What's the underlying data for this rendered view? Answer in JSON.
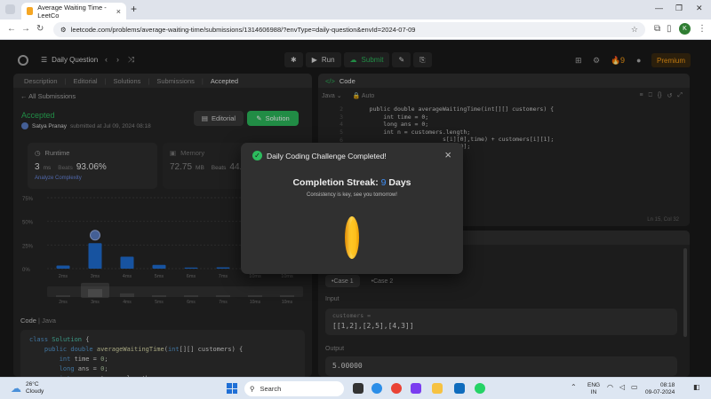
{
  "browser": {
    "tab_title": "Average Waiting Time - LeetCo",
    "url": "leetcode.com/problems/average-waiting-time/submissions/1314606988/?envType=daily-question&envId=2024-07-09",
    "profile_initial": "K"
  },
  "nav": {
    "daily_question": "Daily Question",
    "run": "Run",
    "submit": "Submit",
    "streak_count": "9",
    "premium": "Premium"
  },
  "left": {
    "tabs": [
      "Description",
      "Editorial",
      "Solutions",
      "Submissions",
      "Accepted"
    ],
    "all_submissions": "All Submissions",
    "status": "Accepted",
    "submitter": "Satya Pranay",
    "submitted_on": "submitted at Jul 09, 2024 08:18",
    "editorial_btn": "Editorial",
    "solution_btn": "Solution",
    "runtime": {
      "label": "Runtime",
      "value": "3",
      "unit": "ms",
      "beats_label": "Beats",
      "beats_pct": "93.06%",
      "analyze": "Analyze Complexity"
    },
    "memory": {
      "label": "Memory",
      "value": "72.75",
      "unit": "MB",
      "beats_label": "Beats",
      "beats_pct": "44.0"
    },
    "code_label": "Code",
    "code_lang": "Java",
    "code_lines": [
      "class Solution {",
      "    public double averageWaitingTime(int[][] customers) {",
      "        int time = 0;",
      "        long ans = 0;",
      "        int n = customers.length;"
    ]
  },
  "chart_data": {
    "type": "bar",
    "categories": [
      "2ms",
      "3ms",
      "4ms",
      "5ms",
      "6ms",
      "7ms",
      "10ms",
      "10ms"
    ],
    "values": [
      3.3,
      26.9,
      12.6,
      4.0,
      1.2,
      1.4,
      1.0,
      0.8
    ],
    "highlight_index": 1,
    "y_ticks": [
      "0%",
      "25%",
      "50%",
      "75%"
    ],
    "ylim": [
      0,
      75
    ],
    "grid": true,
    "color": "#1f6fd6"
  },
  "code": {
    "header": "Code",
    "lang": "Java",
    "mode": "Auto",
    "line_numbers": [
      "2",
      "3",
      "4",
      "5",
      "6",
      "7",
      "8",
      "9",
      "10",
      "11",
      "12",
      "13",
      "14"
    ],
    "lines": [
      "    public double averageWaitingTime(int[][] customers) {",
      "        int time = 0;",
      "        long ans = 0;",
      "        int n = customers.length;",
      "",
      "",
      "",
      "",
      "",
      "",
      "",
      "",
      ""
    ],
    "right_fragments": [
      "s[i][0],time) + customers[i][1];",
      "s[i][0];"
    ],
    "cursor": "Ln 15, Col 32"
  },
  "console": {
    "cases": [
      "Case 1",
      "Case 2"
    ],
    "input_label": "Input",
    "input_var": "customers =",
    "input_value": "[[1,2],[2,5],[4,3]]",
    "output_label": "Output",
    "output_value": "5.00000"
  },
  "modal": {
    "title": "Daily Coding Challenge Completed!",
    "streak_label": "Completion Streak:",
    "streak_value": "9",
    "streak_unit": "Days",
    "message": "Consistency is key, see you tomorrow!"
  },
  "taskbar": {
    "temp": "26°C",
    "weather": "Cloudy",
    "search": "Search",
    "lang1": "ENG",
    "lang2": "IN",
    "time": "08:18",
    "date": "09-07-2024"
  }
}
